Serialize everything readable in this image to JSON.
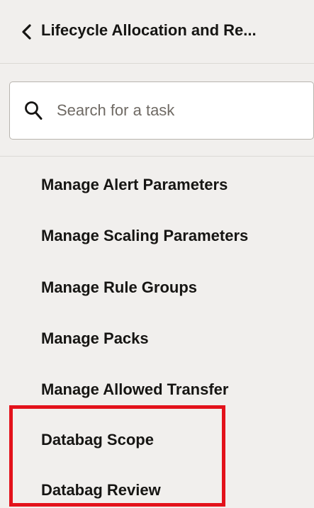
{
  "header": {
    "title": "Lifecycle Allocation and Re..."
  },
  "search": {
    "placeholder": "Search for a task",
    "value": ""
  },
  "tasks": [
    {
      "label": "Manage Alert Parameters"
    },
    {
      "label": "Manage Scaling Parameters"
    },
    {
      "label": "Manage Rule Groups"
    },
    {
      "label": "Manage Packs"
    },
    {
      "label": "Manage Allowed Transfer"
    },
    {
      "label": "Databag Scope"
    },
    {
      "label": "Databag Review"
    }
  ],
  "colors": {
    "background": "#f1efed",
    "text": "#161513",
    "highlight": "#e3121b",
    "placeholder": "#6f6a64"
  },
  "icons": {
    "back": "chevron-left-icon",
    "search": "search-icon"
  }
}
